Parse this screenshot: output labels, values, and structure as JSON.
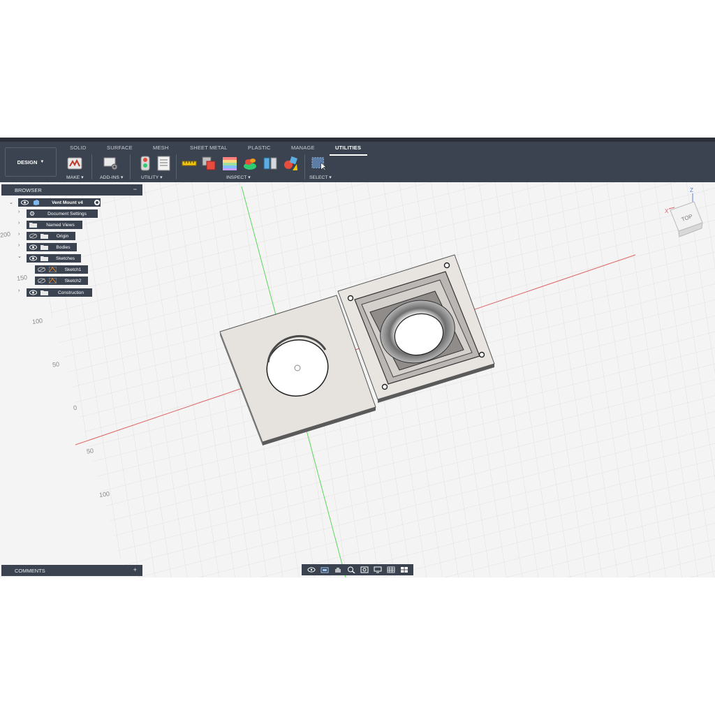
{
  "toolbar": {
    "tabs": [
      "SOLID",
      "SURFACE",
      "MESH",
      "SHEET METAL",
      "PLASTIC",
      "MANAGE",
      "UTILITIES"
    ],
    "active_tab": "UTILITIES",
    "workspace": "DESIGN",
    "groups": {
      "make": "MAKE",
      "addins": "ADD-INS",
      "utility": "UTILITY",
      "inspect": "INSPECT",
      "select": "SELECT"
    }
  },
  "browser": {
    "title": "BROWSER",
    "collapse": "−",
    "root": "Vent Mount v4",
    "items": [
      "Document Settings",
      "Named Views",
      "Origin",
      "Bodies",
      "Sketches",
      "Sketch1",
      "Sketch2",
      "Construction"
    ]
  },
  "comments": {
    "title": "COMMENTS",
    "add": "+"
  },
  "viewcube": {
    "face": "TOP",
    "x_axis": "X",
    "z_axis": "Z"
  },
  "ruler_labels": [
    "200",
    "150",
    "100",
    "50",
    "0",
    "50",
    "100"
  ],
  "colors": {
    "toolbar_bg": "#3b4350",
    "grid": "#d9d9d9",
    "x_axis": "#e06060",
    "y_axis": "#5cd65c"
  }
}
